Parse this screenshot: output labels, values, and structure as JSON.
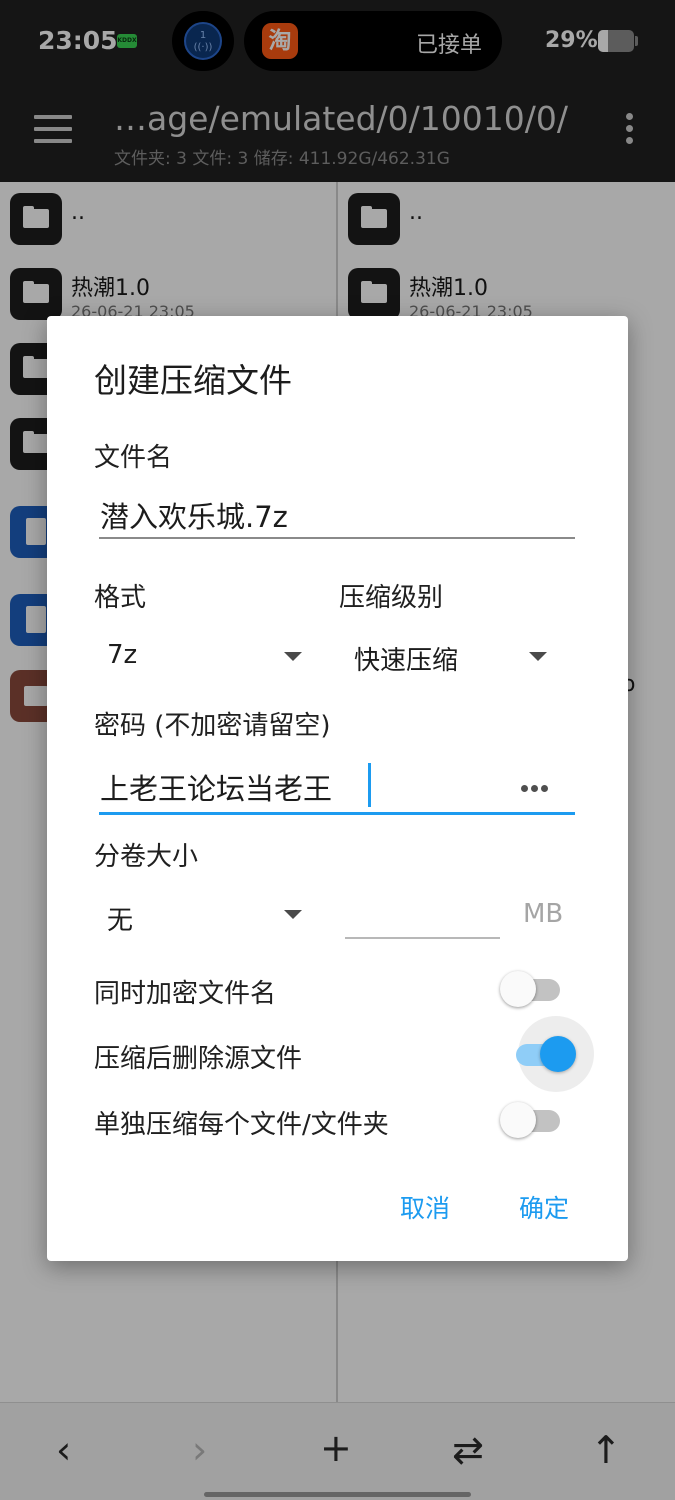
{
  "status_bar": {
    "time": "23:05",
    "chip_label": "KDDX",
    "live_badge": "1",
    "live_icon": "broadcast-icon",
    "island_app_icon": "淘",
    "island_text": "已接单",
    "battery_pct": "29%",
    "battery_level": 0.29
  },
  "app_bar": {
    "path": "…age/emulated/0/10010/0/",
    "summary": "文件夹: 3  文件: 3  储存: 411.92G/462.31G"
  },
  "left_pane": {
    "rows": [
      {
        "icon": "folder-icon",
        "name": ".."
      },
      {
        "icon": "folder-icon",
        "name": "热潮1.0",
        "date": "26-06-21 23:05"
      },
      {
        "icon": "folder-icon",
        "name": ""
      },
      {
        "icon": "folder-icon",
        "name": ""
      },
      {
        "icon": "document-icon",
        "name": ""
      },
      {
        "icon": "document-icon",
        "name": ""
      },
      {
        "icon": "archive-icon",
        "name": ""
      }
    ]
  },
  "right_pane": {
    "rows": [
      {
        "icon": "folder-icon",
        "name": ".."
      },
      {
        "icon": "folder-icon",
        "name": "热潮1.0",
        "date": "26-06-21 23:05"
      }
    ],
    "fragment": "o"
  },
  "dialog": {
    "title": "创建压缩文件",
    "filename_label": "文件名",
    "filename_value": "潜入欢乐城.7z",
    "format_label": "格式",
    "format_value": "7z",
    "level_label": "压缩级别",
    "level_value": "快速压缩",
    "password_label": "密码 (不加密请留空)",
    "password_value": "上老王论坛当老王",
    "split_label": "分卷大小",
    "split_value": "无",
    "split_size_value": "",
    "split_unit": "MB",
    "toggles": [
      {
        "label": "同时加密文件名",
        "on": false
      },
      {
        "label": "压缩后删除源文件",
        "on": true
      },
      {
        "label": "单独压缩每个文件/文件夹",
        "on": false
      }
    ],
    "cancel_label": "取消",
    "ok_label": "确定"
  },
  "bottom_bar": {
    "icons": [
      "back-icon",
      "forward-icon",
      "add-icon",
      "swap-icon",
      "up-icon"
    ],
    "glyphs": [
      "‹",
      "›",
      "+",
      "⇄",
      "↑"
    ]
  }
}
